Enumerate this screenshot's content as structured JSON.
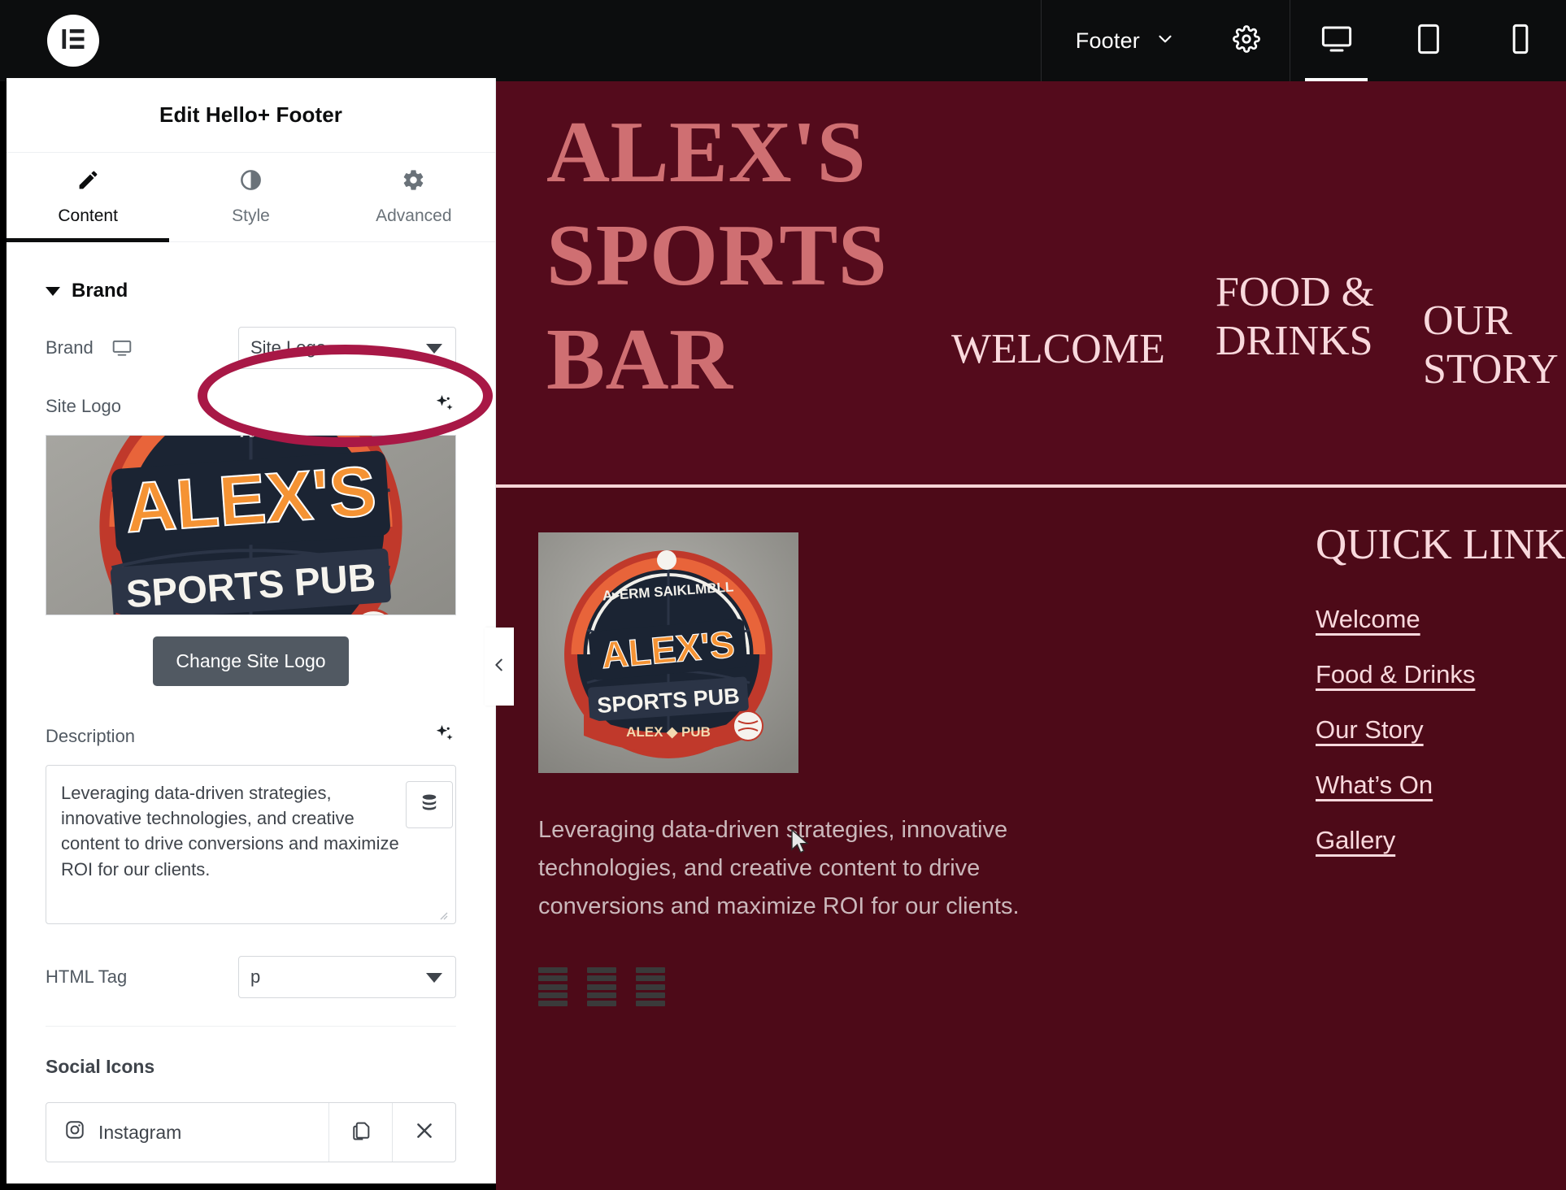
{
  "topbar": {
    "logo_icon": "elementor-logo-icon",
    "document_label": "Footer",
    "chevron_icon": "chevron-down-icon",
    "settings_icon": "gear-icon",
    "devices": [
      {
        "name": "desktop",
        "icon": "desktop-icon",
        "active": true
      },
      {
        "name": "tablet",
        "icon": "tablet-icon",
        "active": false
      },
      {
        "name": "mobile",
        "icon": "mobile-icon",
        "active": false
      }
    ]
  },
  "panel": {
    "title": "Edit Hello+ Footer",
    "tabs": [
      {
        "label": "Content",
        "icon": "pencil-icon",
        "active": true
      },
      {
        "label": "Style",
        "icon": "half-circle-icon",
        "active": false
      },
      {
        "label": "Advanced",
        "icon": "gear-icon",
        "active": false
      }
    ],
    "section": {
      "title": "Brand",
      "caret_icon": "caret-down-icon"
    },
    "brand_control": {
      "label": "Brand",
      "responsive_icon": "desktop-icon",
      "value": "Site Logo",
      "caret_icon": "select-caret-icon"
    },
    "site_logo": {
      "label": "Site Logo",
      "ai_icon": "sparkle-ai-icon",
      "image_alt": "ALEX'S SPORTS PUB",
      "change_button": "Change Site Logo"
    },
    "description": {
      "label": "Description",
      "ai_icon": "sparkle-ai-icon",
      "value": "Leveraging data-driven strategies, innovative technologies, and creative content to drive conversions and maximize ROI for our clients.",
      "dynamic_icon": "database-icon"
    },
    "html_tag": {
      "label": "HTML Tag",
      "value": "p",
      "caret_icon": "select-caret-icon"
    },
    "social_icons": {
      "heading": "Social Icons",
      "items": [
        {
          "label": "Instagram",
          "icon": "instagram-icon",
          "duplicate_icon": "duplicate-icon",
          "remove_icon": "close-icon"
        }
      ]
    }
  },
  "collapse_handle": {
    "icon": "chevron-left-icon"
  },
  "annotation": {
    "shape": "ellipse",
    "color": "#a81846",
    "targets": "brand-select"
  },
  "preview": {
    "hero": {
      "site_title": "ALEX'S SPORTS BAR",
      "nav": [
        {
          "label": "WELCOME"
        },
        {
          "label": "FOOD & DRINKS"
        },
        {
          "label": "OUR STORY"
        }
      ]
    },
    "footer": {
      "logo_alt": "ALEX'S SPORTS PUB",
      "description": "Leveraging data-driven strategies, innovative technologies, and creative content to drive conversions and maximize ROI for our clients.",
      "social_placeholders": 3,
      "quick_links": {
        "title": "QUICK LINKS",
        "links": [
          "Welcome",
          "Food & Drinks",
          "Our Story",
          "What’s On",
          "Gallery"
        ]
      }
    }
  },
  "colors": {
    "topbar_bg": "#0c0d0e",
    "hero_bg": "#540b1c",
    "footer_bg": "#4d0a18",
    "title_accent": "#cf6f72",
    "nav_text": "#f9d9dd",
    "divider": "#f7d4d6",
    "annotation": "#a81846",
    "button_bg": "#515962"
  }
}
